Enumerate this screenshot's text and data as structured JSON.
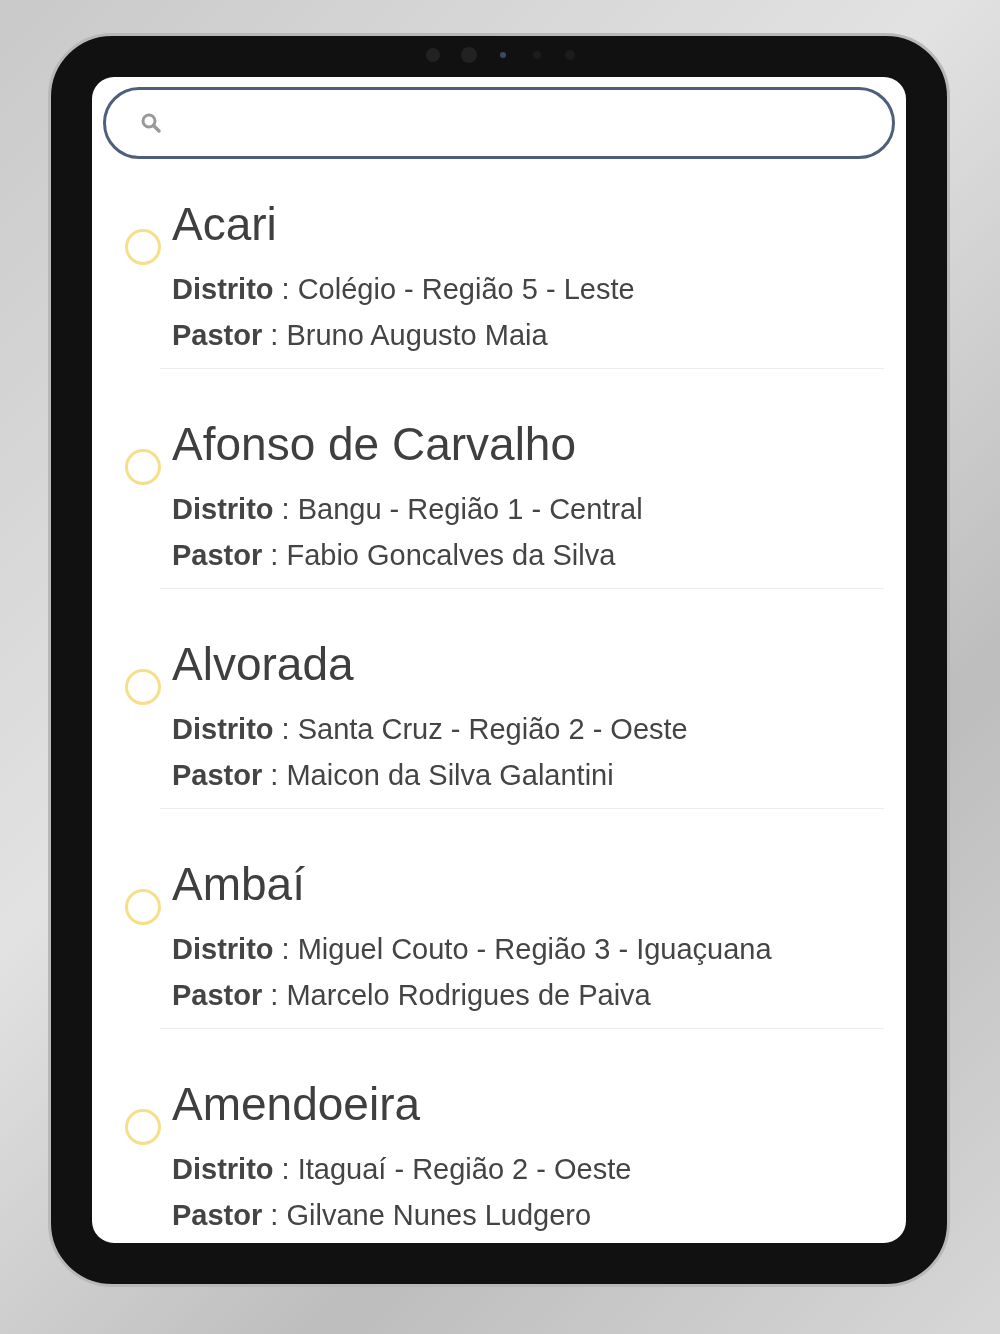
{
  "search": {
    "kind": "search"
  },
  "churches": [
    {
      "name": "Acari",
      "district": "**Distrito** : Colégio - Região 5 - Leste",
      "pastor": "**Pastor** : Bruno Augusto Maia"
    },
    {
      "name": "Afonso de Carvalho",
      "district": "**Distrito** : Bangu - Região 1 - Central",
      "pastor": "**Pastor** : Fabio Goncalves da Silva"
    },
    {
      "name": "Alvorada",
      "district": "**Distrito** : Santa Cruz - Região 2 - Oeste",
      "pastor": "**Pastor** : Maicon da Silva Galantini"
    },
    {
      "name": "Ambaí",
      "district": "**Distrito** : Miguel Couto - Região 3 - Iguaçuana",
      "pastor": "**Pastor** : Marcelo Rodrigues de Paiva"
    },
    {
      "name": "Amendoeira",
      "district": "**Distrito** : Itaguaí - Região 2 - Oeste",
      "pastor": "**Pastor** : Gilvane Nunes Ludgero"
    }
  ]
}
